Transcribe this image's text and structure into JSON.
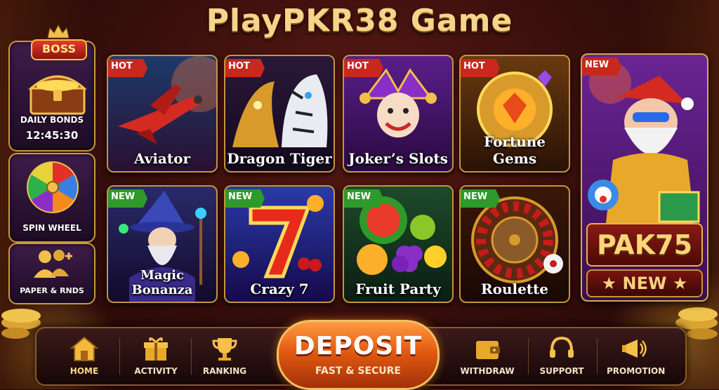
{
  "title": "PlayPKR38 Game",
  "left": {
    "boss": {
      "badge": "BOSS",
      "label": "DAILY BONDS",
      "timer": "12:45:30",
      "icon": "treasure-chest-icon"
    },
    "spin": {
      "label": "SPIN WHEEL",
      "icon": "fortune-wheel-icon"
    },
    "paper": {
      "label": "PAPER & RNDS",
      "icon": "people-icon"
    }
  },
  "games": [
    {
      "name": "Aviator",
      "tag": "HOT"
    },
    {
      "name": "Dragon Tiger",
      "tag": "HOT"
    },
    {
      "name": "Joker’s Slots",
      "tag": "HOT"
    },
    {
      "name": "Fortune Gems",
      "tag": "HOT"
    },
    {
      "name": "Magic Bonanza",
      "tag": "NEW"
    },
    {
      "name": "Crazy 7",
      "tag": "NEW"
    },
    {
      "name": "Fruit Party",
      "tag": "NEW"
    },
    {
      "name": "Roulette",
      "tag": "NEW"
    }
  ],
  "promo": {
    "tag": "NEW",
    "code": "PAK75",
    "label": "★ NEW ★"
  },
  "nav": {
    "home": "HOME",
    "activity": "ACTIVITY",
    "ranking": "RANKING",
    "withdraw": "WITHDRAW",
    "support": "SUPPORT",
    "promotion": "PROMOTION"
  },
  "deposit": {
    "label": "DEPOSIT",
    "sub": "FAST & SECURE"
  },
  "colors": {
    "hot": "#c8281e",
    "new": "#2e9a2a",
    "gold": "#f6d58a",
    "deposit": "#e35a10"
  }
}
